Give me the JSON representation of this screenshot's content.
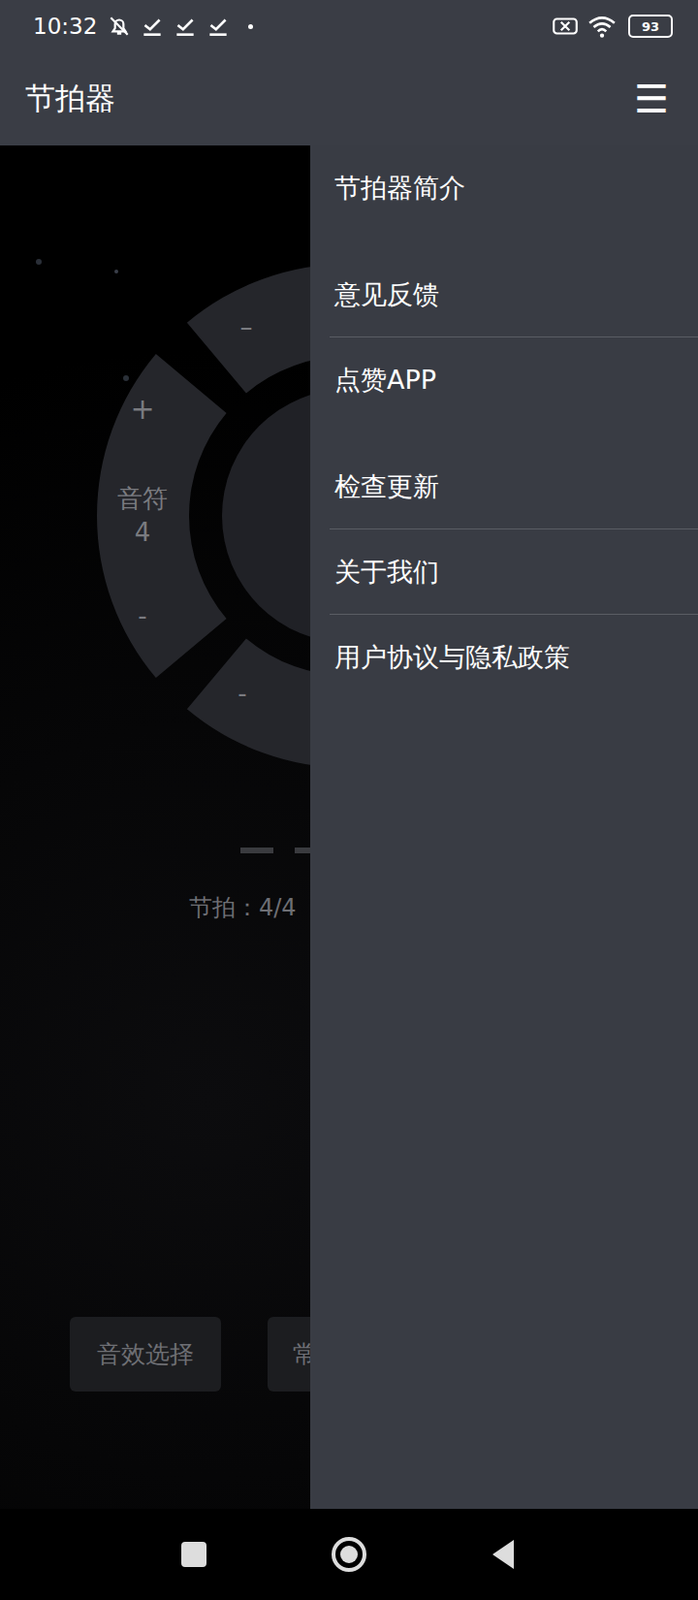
{
  "status_bar": {
    "time": "10:32",
    "battery": "93",
    "silent": true
  },
  "app_bar": {
    "title": "节拍器",
    "menu_icon": "☰"
  },
  "dial": {
    "left_label": "音符",
    "left_value": "4",
    "left_plus": "+",
    "left_minus": "-",
    "top_minus": "–",
    "bottom_minus": "-"
  },
  "beat_display": "节拍：4/4",
  "buttons": [
    "音效选择",
    "常"
  ],
  "drawer": {
    "open": true,
    "items": [
      {
        "label": "节拍器简介",
        "divider": false
      },
      {
        "label": "意见反馈",
        "divider": true
      },
      {
        "label": "点赞APP",
        "divider": false
      },
      {
        "label": "检查更新",
        "divider": true
      },
      {
        "label": "关于我们",
        "divider": true
      },
      {
        "label": "用户协议与隐私政策",
        "divider": false
      }
    ]
  }
}
